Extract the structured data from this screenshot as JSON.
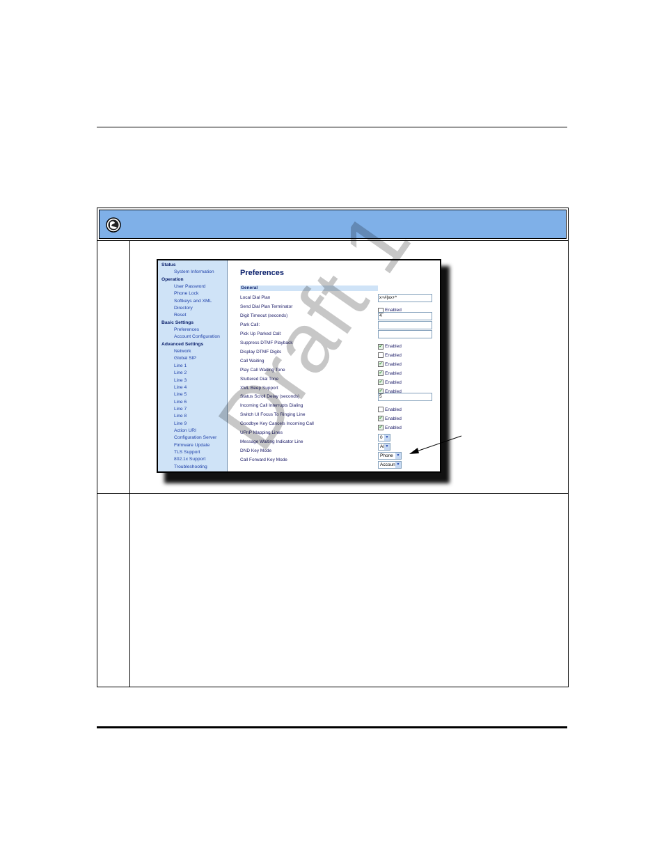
{
  "watermark": "Draft 1",
  "screenshot": {
    "sidebar": [
      {
        "type": "section",
        "label": "Status"
      },
      {
        "type": "item",
        "label": "System Information"
      },
      {
        "type": "section",
        "label": "Operation"
      },
      {
        "type": "item",
        "label": "User Password"
      },
      {
        "type": "item",
        "label": "Phone Lock"
      },
      {
        "type": "item",
        "label": "Softkeys and XML"
      },
      {
        "type": "item",
        "label": "Directory"
      },
      {
        "type": "item",
        "label": "Reset"
      },
      {
        "type": "section",
        "label": "Basic Settings"
      },
      {
        "type": "item",
        "label": "Preferences"
      },
      {
        "type": "item",
        "label": "Account Configuration"
      },
      {
        "type": "section",
        "label": "Advanced Settings"
      },
      {
        "type": "item",
        "label": "Network"
      },
      {
        "type": "item",
        "label": "Global SIP"
      },
      {
        "type": "item",
        "label": "Line 1"
      },
      {
        "type": "item",
        "label": "Line 2"
      },
      {
        "type": "item",
        "label": "Line 3"
      },
      {
        "type": "item",
        "label": "Line 4"
      },
      {
        "type": "item",
        "label": "Line 5"
      },
      {
        "type": "item",
        "label": "Line 6"
      },
      {
        "type": "item",
        "label": "Line 7"
      },
      {
        "type": "item",
        "label": "Line 8"
      },
      {
        "type": "item",
        "label": "Line 9"
      },
      {
        "type": "item",
        "label": "Action URI"
      },
      {
        "type": "item",
        "label": "Configuration Server"
      },
      {
        "type": "item",
        "label": "Firmware Update"
      },
      {
        "type": "item",
        "label": "TLS Support"
      },
      {
        "type": "item",
        "label": "802.1x Support"
      },
      {
        "type": "item",
        "label": "Troubleshooting"
      }
    ],
    "title": "Preferences",
    "section_label": "General",
    "enabled_label": "Enabled",
    "rows": [
      {
        "label": "Local Dial Plan",
        "control": "text",
        "value": "x+#|xx+*"
      },
      {
        "label": "Send Dial Plan Terminator",
        "control": "checkbox",
        "checked": false
      },
      {
        "label": "Digit Timeout (seconds)",
        "control": "text",
        "value": "4"
      },
      {
        "label": "Park Call:",
        "control": "text",
        "value": ""
      },
      {
        "label": "Pick Up Parked Call:",
        "control": "text",
        "value": ""
      },
      {
        "label": "Suppress DTMF Playback",
        "control": "checkbox",
        "checked": true
      },
      {
        "label": "Display DTMF Digits",
        "control": "checkbox",
        "checked": false
      },
      {
        "label": "Call Waiting",
        "control": "checkbox",
        "checked": true
      },
      {
        "label": "Play Call Waiting Tone",
        "control": "checkbox",
        "checked": true
      },
      {
        "label": "Stuttered Dial Tone",
        "control": "checkbox",
        "checked": true
      },
      {
        "label": "XML Beep Support",
        "control": "checkbox",
        "checked": true
      },
      {
        "label": "Status Scroll Delay (seconds)",
        "control": "text",
        "value": "5"
      },
      {
        "label": "Incoming Call Interrupts Dialing",
        "control": "checkbox",
        "checked": false
      },
      {
        "label": "Switch UI Focus To Ringing Line",
        "control": "checkbox",
        "checked": true
      },
      {
        "label": "Goodbye Key Cancels Incoming Call",
        "control": "checkbox",
        "checked": true
      },
      {
        "label": "UPnP Mapping Lines",
        "control": "select",
        "value": "0"
      },
      {
        "label": "Message Waiting Indicator Line",
        "control": "select",
        "value": "All"
      },
      {
        "label": "DND Key Mode",
        "control": "select",
        "value": "Phone"
      },
      {
        "label": "Call Forward Key Mode",
        "control": "select",
        "value": "Account"
      }
    ]
  },
  "icons": {
    "header": "globe-icon",
    "pointer": "arrow-icon"
  },
  "colors": {
    "header_bar": "#7fb0e8",
    "sidebar": "#cfe3f7",
    "title": "#0a1f6b"
  }
}
